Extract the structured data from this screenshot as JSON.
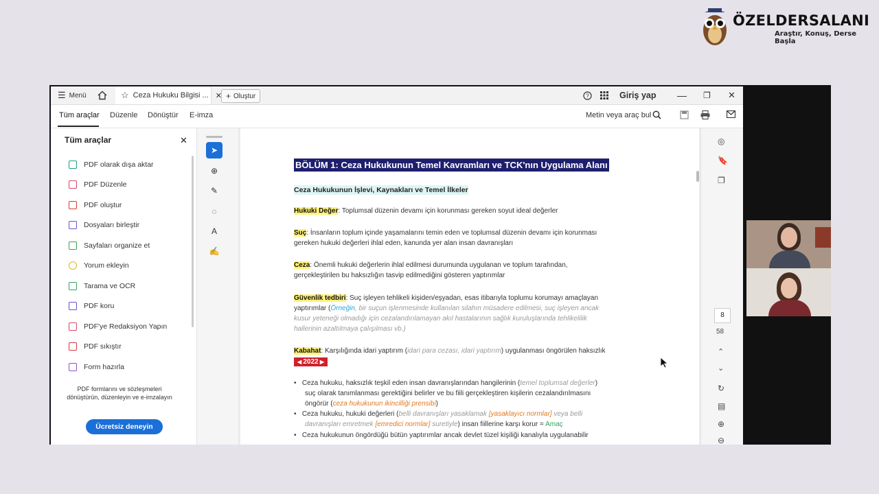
{
  "brand": {
    "name": "ÖZELDERSALANI",
    "tagline": "Araştır, Konuş, Derse Başla"
  },
  "titlebar": {
    "menu_label": "Menü",
    "tab_title": "Ceza Hukuku Bilgisi ...",
    "new_label": "Oluştur",
    "signin_label": "Giriş yap"
  },
  "toolbar": {
    "tabs": [
      "Tüm araçlar",
      "Düzenle",
      "Dönüştür",
      "E-imza"
    ],
    "search_label": "Metin veya araç bul"
  },
  "left_panel": {
    "title": "Tüm araçlar",
    "items": [
      {
        "label": "PDF olarak dışa aktar",
        "color": "#1a9e7a"
      },
      {
        "label": "PDF Düzenle",
        "color": "#d2466a"
      },
      {
        "label": "PDF oluştur",
        "color": "#d8372c"
      },
      {
        "label": "Dosyaları birleştir",
        "color": "#6a4fd8"
      },
      {
        "label": "Sayfaları organize et",
        "color": "#3ea14a"
      },
      {
        "label": "Yorum ekleyin",
        "color": "#e0b325"
      },
      {
        "label": "Tarama ve OCR",
        "color": "#2fa35c"
      },
      {
        "label": "PDF koru",
        "color": "#6d4fc4"
      },
      {
        "label": "PDF'ye Redaksiyon Yapın",
        "color": "#d2466a"
      },
      {
        "label": "PDF sıkıştır",
        "color": "#d2353a"
      },
      {
        "label": "Form hazırla",
        "color": "#8a4fd8"
      }
    ],
    "promo_text_1": "PDF formlarını ve sözleşmeleri",
    "promo_text_2": "dönüştürün, düzenleyin ve e-imzalayın",
    "cta_label": "Ücretsiz deneyin"
  },
  "document": {
    "chapter_title": "BÖLÜM 1: Ceza Hukukunun Temel Kavramları ve TCK'nın Uygulama Alanı",
    "section_title": "Ceza Hukukunun İşlevi, Kaynakları ve Temel İlkeler",
    "p1_term": "Hukuki Değer",
    "p1_text": ": Toplumsal düzenin devamı için korunması gereken soyut ideal değerler",
    "p2_term": "Suç",
    "p2_line1": ": İnsanların toplum içinde yaşamalarını temin eden ve toplumsal düzenin devamı için korunması",
    "p2_line2": "gereken hukuki değerleri ihlal eden, kanunda yer alan insan davranışları",
    "p3_term": "Ceza",
    "p3_line1": ": Önemli hukuki değerlerin ihlal edilmesi durumunda uygulanan ve toplum tarafından,",
    "p3_line2": "gerçekleştirilen bu haksızlığın tasvip edilmediğini gösteren yaptırımlar",
    "p4_term": "Güvenlik tedbiri",
    "p4_line1": ": Suç işleyen tehlikeli kişiden/eşyadan, esas itibarıyla toplumu korumayı amaçlayan",
    "p4_line2_a": "yaptırımlar (",
    "p4_line2_b": "Örneğin",
    "p4_line2_c": ", bir suçun işlenmesinde kullanılan silahın müsadere edilmesi, suç işleyen ancak",
    "p4_line3": "kusur yeteneği olmadığı için cezalandırılamayan akıl hastalarının sağlık kuruluşlarında tehlikelilik",
    "p4_line4": "hallerinin azaltılmaya çalışılması vb.)",
    "p5_term": "Kabahat",
    "p5_text_a": ": Karşılığında idari yaptırım (",
    "p5_text_b": "idari para cezası, idari yaptırım",
    "p5_text_c": ") uygulanması öngörülen haksızlık",
    "year_badge": "2022",
    "b1_line1_a": "Ceza hukuku, haksızlık teşkil eden insan davranışlarından hangilerinin (",
    "b1_line1_b": "temel toplumsal değerler",
    "b1_line1_c": ")",
    "b1_line2": "suç olarak tanımlanması gerektiğini belirler ve bu fiili gerçekleştiren kişilerin cezalandırılmasını",
    "b1_line3_a": "öngörür (",
    "b1_line3_b": "ceza hukukunun ikincilliği prensibi",
    "b1_line3_c": ")",
    "b2_line1_a": "Ceza hukuku, hukuki değerleri (",
    "b2_line1_b": "belli davranışları yasaklamak",
    "b2_line1_c": "[yasaklayıcı normlar]",
    "b2_line1_d": " veya belli",
    "b2_line2_a": "davranışları emretmek",
    "b2_line2_b": "[emredici normlar]",
    "b2_line2_c": " suretiyle",
    "b2_line2_d": ") insan fiillerine karşı korur = ",
    "b2_line2_e": "Amaç",
    "b3_line1": "Ceza hukukunun öngördüğü bütün yaptırımlar ancak devlet tüzel kişiliği kanalıyla uygulanabilir"
  },
  "page_nav": {
    "current": "8",
    "total": "58"
  }
}
